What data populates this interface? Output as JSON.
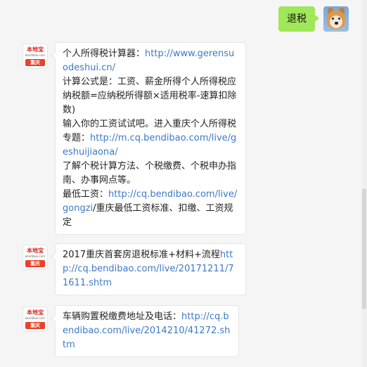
{
  "outgoing": {
    "text": "退税"
  },
  "brand": {
    "name": "本地宝",
    "domain": "bendibao.com",
    "city": "重庆"
  },
  "messages": [
    {
      "segments": [
        {
          "text": "个人所得税计算器：",
          "link": false
        },
        {
          "text": "http://www.gerensuodeshui.cn/",
          "link": true
        },
        {
          "text": "计算公式是：工资、薪金所得个人所得税应纳税额=应纳税所得额×适用税率-速算扣除数)",
          "link": false
        },
        {
          "text": "输入你的工资试试吧。进入重庆个人所得税专题：",
          "link": false
        },
        {
          "text": "http://m.cq.bendibao.com/live/geshuijiaona/",
          "link": true
        },
        {
          "text": "了解个税计算方法、个税缴费、个税申办指南、办事网点等。",
          "link": false
        },
        {
          "text": "最低工资：",
          "link": false
        },
        {
          "text": "http://cq.bendibao.com/live/gongzi",
          "link": true
        },
        {
          "text": "/重庆最低工资标准、扣缴、工资规定",
          "link": false
        }
      ]
    },
    {
      "segments": [
        {
          "text": "2017重庆首套房退税标准+材料+流程",
          "link": false
        },
        {
          "text": "http://cq.bendibao.com/live/20171211/71611.shtm",
          "link": true
        }
      ]
    },
    {
      "segments": [
        {
          "text": "车辆购置税缴费地址及电话：",
          "link": false
        },
        {
          "text": "http://cq.bendibao.com/live/2014210/41272.shtm",
          "link": true
        }
      ]
    }
  ]
}
